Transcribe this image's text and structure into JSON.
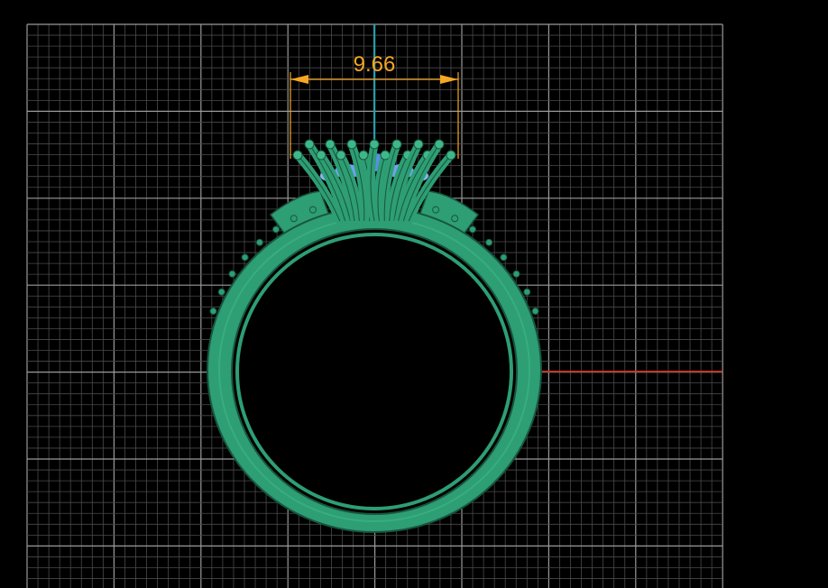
{
  "viewport": {
    "background": "#000000",
    "grid_color": "#808080",
    "x_axis_color": "#c0392b",
    "y_axis_color": "#1fa0b0"
  },
  "dimension": {
    "value": "9.66",
    "color": "#f5a623"
  },
  "model": {
    "name": "ring",
    "metal_color": "#2e9e74",
    "metal_dark": "#17563f",
    "gem_color": "#5b8ee6"
  }
}
